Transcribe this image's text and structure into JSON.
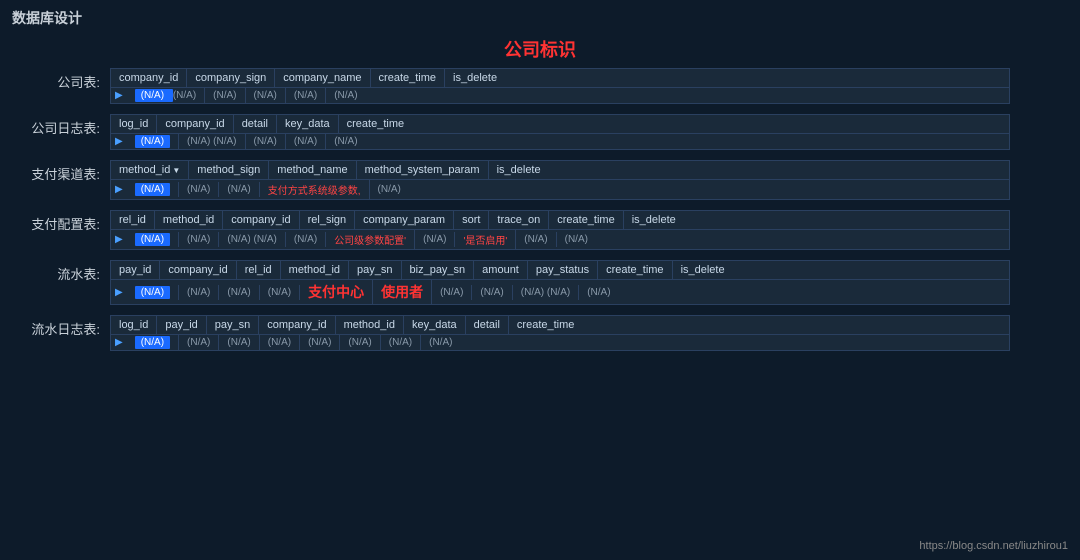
{
  "page": {
    "title": "数据库设计",
    "center_label": "公司标识",
    "footer_link": "https://blog.csdn.net/liuzhirou1"
  },
  "tables": [
    {
      "label": "公司表:",
      "columns": [
        "company_id",
        "company_sign",
        "company_name",
        "create_time",
        "is_delete"
      ],
      "row_cells": [
        "(N/A) (N/A)",
        "(N/A)",
        "(N/A)",
        "(N/A)",
        "(N/A)"
      ],
      "has_pk": false,
      "col_widths": [
        "90px",
        "90px",
        "100px",
        "90px",
        "70px"
      ]
    },
    {
      "label": "公司日志表:",
      "columns": [
        "log_id",
        "company_id",
        "detail",
        "key_data",
        "create_time"
      ],
      "row_cells": [
        "(N/A)",
        "(N/A) (N/A)",
        "(N/A)",
        "(N/A)",
        ""
      ],
      "has_pk": false,
      "col_widths": [
        "70px",
        "90px",
        "60px",
        "70px",
        "80px"
      ]
    },
    {
      "label": "支付渠道表:",
      "columns": [
        "method_id",
        "method_sign",
        "method_name",
        "method_system_param",
        "is_delete"
      ],
      "row_cells": [
        "(N/A)",
        "(N/A)",
        "(N/A)",
        "支付方式系统级参数,",
        "(N/A)"
      ],
      "has_pk": true,
      "col_widths": [
        "80px",
        "90px",
        "90px",
        "130px",
        "70px"
      ]
    },
    {
      "label": "支付配置表:",
      "columns": [
        "rel_id",
        "method_id",
        "company_id",
        "rel_sign",
        "company_param",
        "sort",
        "trace_on",
        "create_time",
        "is_delete"
      ],
      "row_cells": [
        "(N/A)",
        "(N/A)",
        "(N/A) (N/A)",
        "(N/A)",
        "公司级参数配置'",
        "(N/A)",
        "'是否启用'",
        "(N/A)",
        "(N/A)"
      ],
      "has_pk": false,
      "col_widths": [
        "50px",
        "70px",
        "80px",
        "60px",
        "90px",
        "40px",
        "70px",
        "80px",
        "60px"
      ]
    },
    {
      "label": "流水表:",
      "columns": [
        "pay_id",
        "company_id",
        "rel_id",
        "method_id",
        "pay_sn",
        "biz_pay_sn",
        "amount",
        "pay_status",
        "create_time",
        "is_delete"
      ],
      "row_cells": [
        "(N/A)",
        "(N/A)",
        "(N/A)",
        "(N/A)",
        "支付中心",
        "使用者",
        "(N/A)",
        "(N/A)",
        "(N/A) (N/A)",
        "(N/A)"
      ],
      "has_pk": false,
      "col_widths": [
        "55px",
        "70px",
        "50px",
        "70px",
        "70px",
        "70px",
        "55px",
        "70px",
        "80px",
        "60px"
      ],
      "special_cells": [
        4,
        5
      ]
    },
    {
      "label": "流水日志表:",
      "columns": [
        "log_id",
        "pay_id",
        "pay_sn",
        "company_id",
        "method_id",
        "key_data",
        "detail",
        "create_time"
      ],
      "row_cells": [
        "(N/A)",
        "(N/A)",
        "(N/A)",
        "(N/A)",
        "(N/A)",
        "(N/A)",
        "(N/A)",
        "(N/A)"
      ],
      "has_pk": false,
      "col_widths": [
        "60px",
        "55px",
        "60px",
        "80px",
        "70px",
        "70px",
        "60px",
        "80px"
      ]
    }
  ]
}
